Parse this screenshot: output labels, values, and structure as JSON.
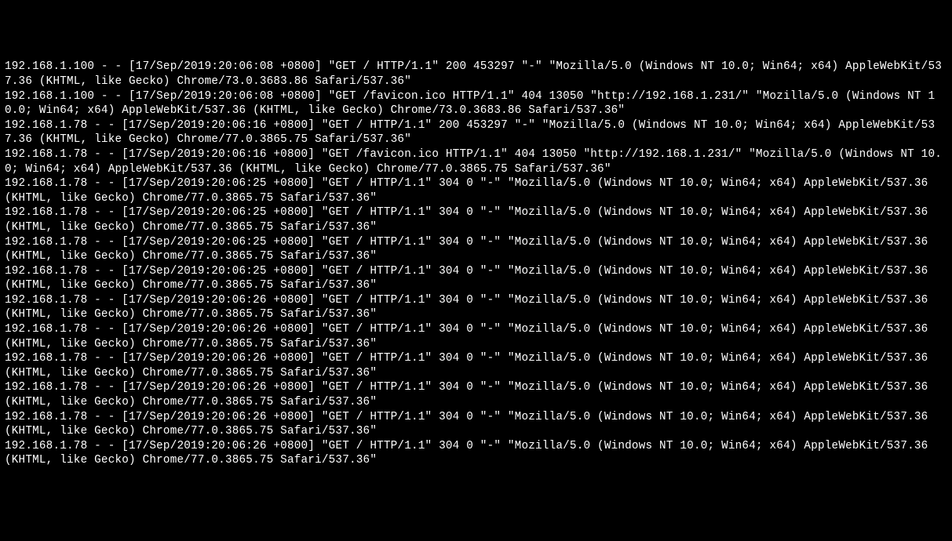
{
  "log": {
    "entries": [
      "192.168.1.100 - - [17/Sep/2019:20:06:08 +0800] \"GET / HTTP/1.1\" 200 453297 \"-\" \"Mozilla/5.0 (Windows NT 10.0; Win64; x64) AppleWebKit/537.36 (KHTML, like Gecko) Chrome/73.0.3683.86 Safari/537.36\"",
      "192.168.1.100 - - [17/Sep/2019:20:06:08 +0800] \"GET /favicon.ico HTTP/1.1\" 404 13050 \"http://192.168.1.231/\" \"Mozilla/5.0 (Windows NT 10.0; Win64; x64) AppleWebKit/537.36 (KHTML, like Gecko) Chrome/73.0.3683.86 Safari/537.36\"",
      "192.168.1.78 - - [17/Sep/2019:20:06:16 +0800] \"GET / HTTP/1.1\" 200 453297 \"-\" \"Mozilla/5.0 (Windows NT 10.0; Win64; x64) AppleWebKit/537.36 (KHTML, like Gecko) Chrome/77.0.3865.75 Safari/537.36\"",
      "192.168.1.78 - - [17/Sep/2019:20:06:16 +0800] \"GET /favicon.ico HTTP/1.1\" 404 13050 \"http://192.168.1.231/\" \"Mozilla/5.0 (Windows NT 10.0; Win64; x64) AppleWebKit/537.36 (KHTML, like Gecko) Chrome/77.0.3865.75 Safari/537.36\"",
      "192.168.1.78 - - [17/Sep/2019:20:06:25 +0800] \"GET / HTTP/1.1\" 304 0 \"-\" \"Mozilla/5.0 (Windows NT 10.0; Win64; x64) AppleWebKit/537.36 (KHTML, like Gecko) Chrome/77.0.3865.75 Safari/537.36\"",
      "192.168.1.78 - - [17/Sep/2019:20:06:25 +0800] \"GET / HTTP/1.1\" 304 0 \"-\" \"Mozilla/5.0 (Windows NT 10.0; Win64; x64) AppleWebKit/537.36 (KHTML, like Gecko) Chrome/77.0.3865.75 Safari/537.36\"",
      "192.168.1.78 - - [17/Sep/2019:20:06:25 +0800] \"GET / HTTP/1.1\" 304 0 \"-\" \"Mozilla/5.0 (Windows NT 10.0; Win64; x64) AppleWebKit/537.36 (KHTML, like Gecko) Chrome/77.0.3865.75 Safari/537.36\"",
      "192.168.1.78 - - [17/Sep/2019:20:06:25 +0800] \"GET / HTTP/1.1\" 304 0 \"-\" \"Mozilla/5.0 (Windows NT 10.0; Win64; x64) AppleWebKit/537.36 (KHTML, like Gecko) Chrome/77.0.3865.75 Safari/537.36\"",
      "192.168.1.78 - - [17/Sep/2019:20:06:26 +0800] \"GET / HTTP/1.1\" 304 0 \"-\" \"Mozilla/5.0 (Windows NT 10.0; Win64; x64) AppleWebKit/537.36 (KHTML, like Gecko) Chrome/77.0.3865.75 Safari/537.36\"",
      "192.168.1.78 - - [17/Sep/2019:20:06:26 +0800] \"GET / HTTP/1.1\" 304 0 \"-\" \"Mozilla/5.0 (Windows NT 10.0; Win64; x64) AppleWebKit/537.36 (KHTML, like Gecko) Chrome/77.0.3865.75 Safari/537.36\"",
      "192.168.1.78 - - [17/Sep/2019:20:06:26 +0800] \"GET / HTTP/1.1\" 304 0 \"-\" \"Mozilla/5.0 (Windows NT 10.0; Win64; x64) AppleWebKit/537.36 (KHTML, like Gecko) Chrome/77.0.3865.75 Safari/537.36\"",
      "192.168.1.78 - - [17/Sep/2019:20:06:26 +0800] \"GET / HTTP/1.1\" 304 0 \"-\" \"Mozilla/5.0 (Windows NT 10.0; Win64; x64) AppleWebKit/537.36 (KHTML, like Gecko) Chrome/77.0.3865.75 Safari/537.36\"",
      "192.168.1.78 - - [17/Sep/2019:20:06:26 +0800] \"GET / HTTP/1.1\" 304 0 \"-\" \"Mozilla/5.0 (Windows NT 10.0; Win64; x64) AppleWebKit/537.36 (KHTML, like Gecko) Chrome/77.0.3865.75 Safari/537.36\"",
      "192.168.1.78 - - [17/Sep/2019:20:06:26 +0800] \"GET / HTTP/1.1\" 304 0 \"-\" \"Mozilla/5.0 (Windows NT 10.0; Win64; x64) AppleWebKit/537.36 (KHTML, like Gecko) Chrome/77.0.3865.75 Safari/537.36\""
    ]
  }
}
